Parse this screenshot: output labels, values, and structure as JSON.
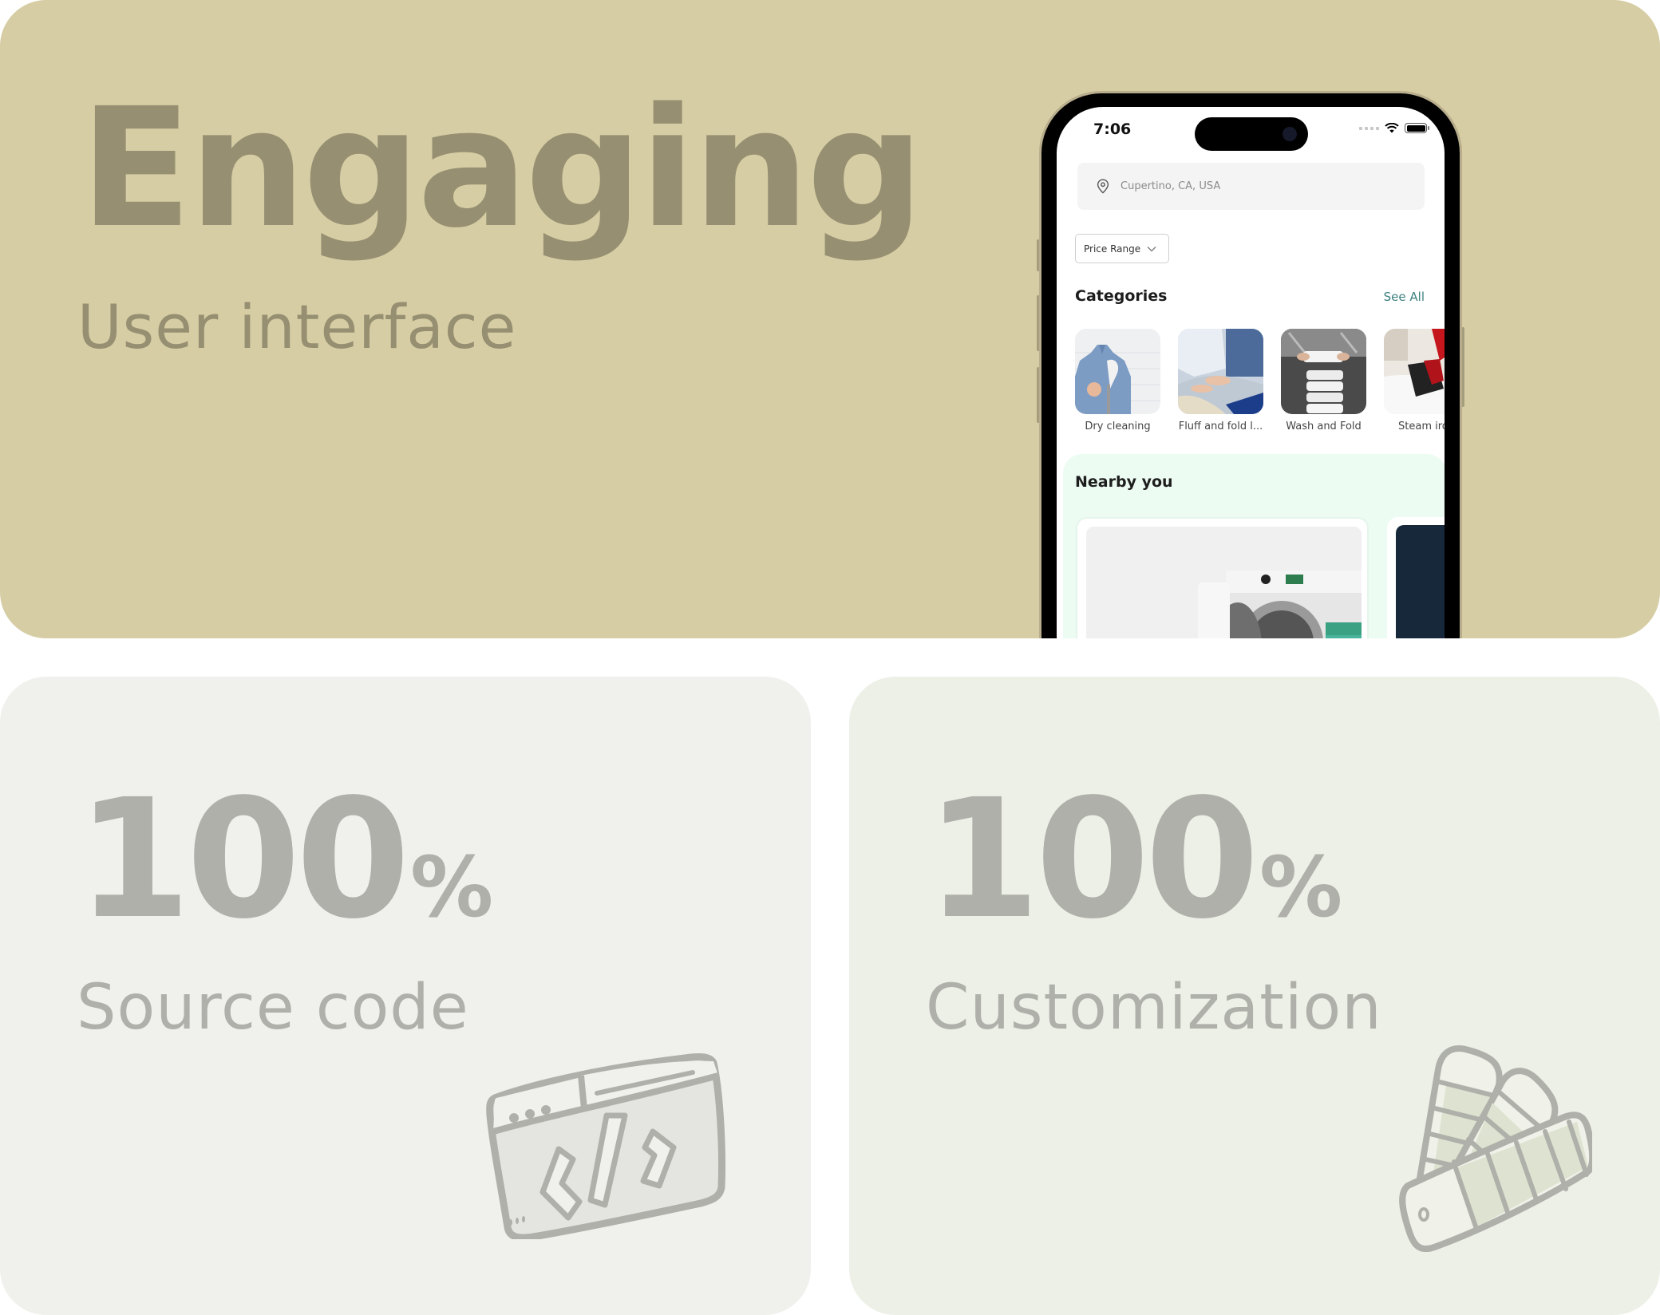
{
  "hero": {
    "title": "Engaging",
    "subtitle": "User interface"
  },
  "stats": [
    {
      "value": "100",
      "unit": "%",
      "label": "Source code",
      "icon": "code-window-icon"
    },
    {
      "value": "100",
      "unit": "%",
      "label": "Customization",
      "icon": "color-palette-icon"
    }
  ],
  "phone": {
    "status_time": "7:06",
    "search": {
      "placeholder": "Cupertino, CA, USA",
      "icon": "location-pin-icon"
    },
    "filter": {
      "label": "Price Range",
      "icon": "chevron-down-icon"
    },
    "categories": {
      "title": "Categories",
      "see_all": "See All",
      "items": [
        {
          "label": "Dry cleaning"
        },
        {
          "label": "Fluff and fold l..."
        },
        {
          "label": "Wash and Fold"
        },
        {
          "label": "Steam iron"
        }
      ]
    },
    "nearby": {
      "title": "Nearby you"
    }
  },
  "colors": {
    "hero_bg": "#d6cda4",
    "hero_text": "#968f71",
    "source_bg": "#f0f1ec",
    "custom_bg": "#edf0e7",
    "stat_text": "#afb0aa",
    "accent_link": "#3e7f7f",
    "nearby_bg": "#edfcf3"
  }
}
